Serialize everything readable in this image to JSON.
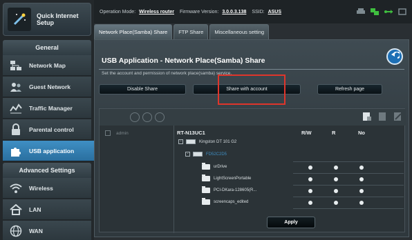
{
  "sidebar": {
    "quick_setup": {
      "label": "Quick Internet Setup",
      "icon": "wand-icon"
    },
    "general_header": "General",
    "general_items": [
      {
        "label": "Network Map",
        "icon": "network-map-icon"
      },
      {
        "label": "Guest Network",
        "icon": "guest-network-icon"
      },
      {
        "label": "Traffic Manager",
        "icon": "traffic-manager-icon"
      },
      {
        "label": "Parental control",
        "icon": "lock-icon"
      },
      {
        "label": "USB application",
        "icon": "puzzle-icon",
        "active": true
      }
    ],
    "advanced_header": "Advanced Settings",
    "advanced_items": [
      {
        "label": "Wireless",
        "icon": "wifi-icon"
      },
      {
        "label": "LAN",
        "icon": "home-icon"
      },
      {
        "label": "WAN",
        "icon": "globe-icon"
      }
    ]
  },
  "topbar": {
    "op_mode_label": "Operation Mode:",
    "op_mode_value": "Wireless router",
    "firmware_label": "Firmware Version:",
    "firmware_value": "3.0.0.3.138",
    "ssid_label": "SSID:",
    "ssid_value": "ASUS",
    "status_icons": [
      "printer-icon",
      "network-status-icon",
      "usb-icon",
      "tools-icon"
    ]
  },
  "tabs": [
    {
      "label": "Network Place(Samba) Share",
      "active": true
    },
    {
      "label": "FTP Share",
      "active": false
    },
    {
      "label": "Miscellaneous setting",
      "active": false
    }
  ],
  "main": {
    "title": "USB Application - Network Place(Samba) Share",
    "description": "Set the account and permission of network place(samba) service.",
    "buttons": {
      "disable": "Disable Share",
      "share_with_account": "Share with account",
      "refresh": "Refresh page"
    },
    "account": "admin",
    "tree": {
      "device": "RT-N13UC1",
      "columns": [
        "R/W",
        "R",
        "No"
      ],
      "disk": "Kingston DT 101 G2",
      "partition": "FD52C2D5",
      "folders": [
        {
          "name": "urDrive"
        },
        {
          "name": "LightScreenPortable"
        },
        {
          "name": "PCI-DKara-128605(R..."
        },
        {
          "name": "screencaps_edited"
        }
      ]
    },
    "apply_label": "Apply"
  },
  "colors": {
    "accent_blue": "#2f7bb0",
    "highlight_red": "#e0352b",
    "panel_bg": "#353f45"
  }
}
